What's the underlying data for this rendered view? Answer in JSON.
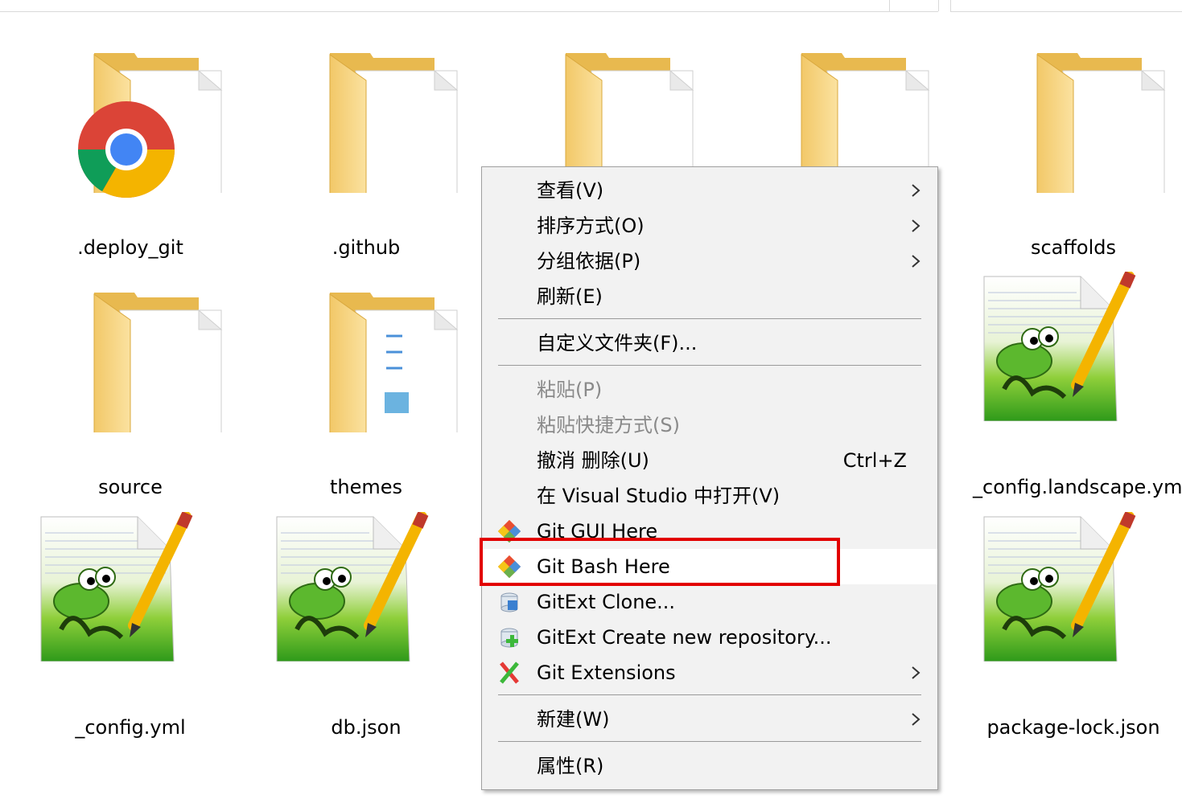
{
  "files": [
    {
      "name": ".deploy_git",
      "icon": "folder-chrome-icon"
    },
    {
      "name": ".github",
      "icon": "folder-icon"
    },
    {
      "name": "",
      "icon": "folder-notepad-icon"
    },
    {
      "name": "",
      "icon": "folder-icon"
    },
    {
      "name": "scaffolds",
      "icon": "folder-icon"
    },
    {
      "name": "source",
      "icon": "folder-icon"
    },
    {
      "name": "themes",
      "icon": "folder-docs-icon"
    },
    {
      "name": "_config.landscape.yml",
      "icon": "notepad-file-icon"
    },
    {
      "name": "_config.yml",
      "icon": "notepad-file-icon"
    },
    {
      "name": "db.json",
      "icon": "notepad-file-icon"
    },
    {
      "name": "package-lock.json",
      "icon": "notepad-file-icon"
    }
  ],
  "context_menu": {
    "items": [
      {
        "label": "查看(V)",
        "submenu": true
      },
      {
        "label": "排序方式(O)",
        "submenu": true
      },
      {
        "label": "分组依据(P)",
        "submenu": true
      },
      {
        "label": "刷新(E)"
      },
      {
        "label": "自定义文件夹(F)..."
      },
      {
        "label": "粘贴(P)",
        "disabled": true
      },
      {
        "label": "粘贴快捷方式(S)",
        "disabled": true
      },
      {
        "label": "撤消 删除(U)",
        "shortcut": "Ctrl+Z"
      },
      {
        "label": "在 Visual Studio 中打开(V)"
      },
      {
        "label": "Git GUI Here",
        "icon": "git-gui-icon"
      },
      {
        "label": "Git Bash Here",
        "icon": "git-bash-icon",
        "highlighted": true
      },
      {
        "label": "GitExt Clone...",
        "icon": "gitext-clone-icon"
      },
      {
        "label": "GitExt Create new repository...",
        "icon": "gitext-create-repo-icon"
      },
      {
        "label": "Git Extensions",
        "icon": "git-extensions-icon",
        "submenu": true
      },
      {
        "label": "新建(W)",
        "submenu": true
      },
      {
        "label": "属性(R)"
      }
    ]
  },
  "colors": {
    "highlight_box": "#e20000",
    "menu_background": "#f2f2f2",
    "folder": "#f5d27a",
    "disabled_text": "#8a8a8a"
  }
}
